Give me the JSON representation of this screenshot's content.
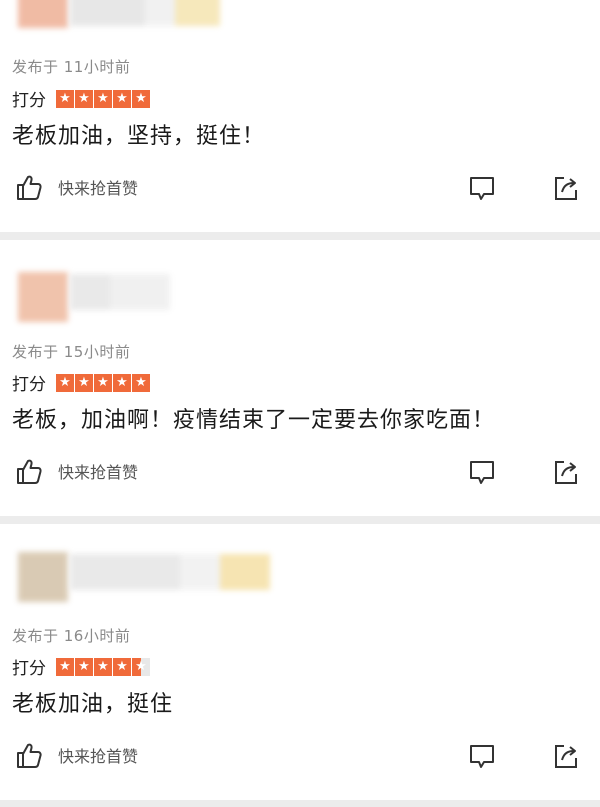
{
  "comments": [
    {
      "published": "发布于 11小时前",
      "rating_label": "打分",
      "rating": 5,
      "text": "老板加油，坚持，挺住！",
      "like_label": "快来抢首赞"
    },
    {
      "published": "发布于 15小时前",
      "rating_label": "打分",
      "rating": 5,
      "text": "老板，加油啊！疫情结束了一定要去你家吃面！",
      "like_label": "快来抢首赞"
    },
    {
      "published": "发布于 16小时前",
      "rating_label": "打分",
      "rating": 4.5,
      "text": "老板加油，挺住",
      "like_label": "快来抢首赞"
    }
  ],
  "icons": {
    "like": "thumbs-up-icon",
    "reply": "comment-icon",
    "share": "share-icon"
  },
  "colors": {
    "star": "#f06a3a",
    "background": "#ececec",
    "card": "#ffffff",
    "meta_text": "#8a8a8a"
  }
}
